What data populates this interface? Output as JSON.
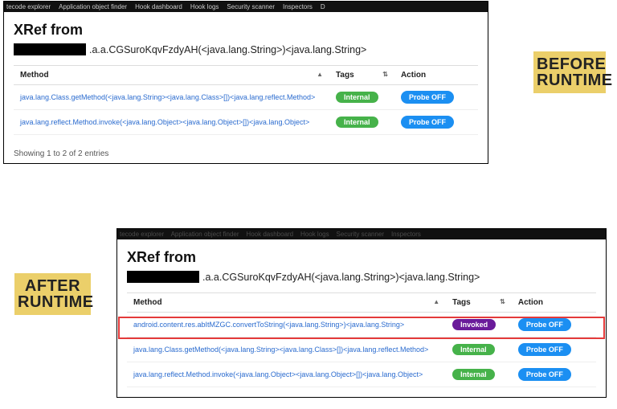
{
  "labels": {
    "before": "BEFORE RUNTIME",
    "after": "AFTER RUNTIME"
  },
  "tabs": {
    "items": [
      "tecode explorer",
      "Application object finder",
      "Hook dashboard",
      "Hook logs",
      "Security scanner",
      "Inspectors",
      "D"
    ]
  },
  "xref": {
    "title": "XRef from",
    "method_prefix": ".a.a.CGSuroKqvFzdyAH(<java.lang.String>)<java.lang.String>",
    "columns": {
      "method": "Method",
      "tags": "Tags",
      "action": "Action"
    },
    "action_label": "Probe OFF"
  },
  "before": {
    "rows": [
      {
        "method": "java.lang.Class.getMethod(<java.lang.String><java.lang.Class>[])<java.lang.reflect.Method>",
        "tag": "Internal",
        "tagClass": "tag-green"
      },
      {
        "method": "java.lang.reflect.Method.invoke(<java.lang.Object><java.lang.Object>[])<java.lang.Object>",
        "tag": "Internal",
        "tagClass": "tag-green"
      }
    ],
    "footer": "Showing 1 to 2 of 2 entries"
  },
  "after": {
    "rows": [
      {
        "method": "android.content.res.abItMZGC.convertToString(<java.lang.String>)<java.lang.String>",
        "tag": "Invoked",
        "tagClass": "tag-purple"
      },
      {
        "method": "java.lang.Class.getMethod(<java.lang.String><java.lang.Class>[])<java.lang.reflect.Method>",
        "tag": "Internal",
        "tagClass": "tag-green"
      },
      {
        "method": "java.lang.reflect.Method.invoke(<java.lang.Object><java.lang.Object>[])<java.lang.Object>",
        "tag": "Internal",
        "tagClass": "tag-green"
      }
    ]
  }
}
